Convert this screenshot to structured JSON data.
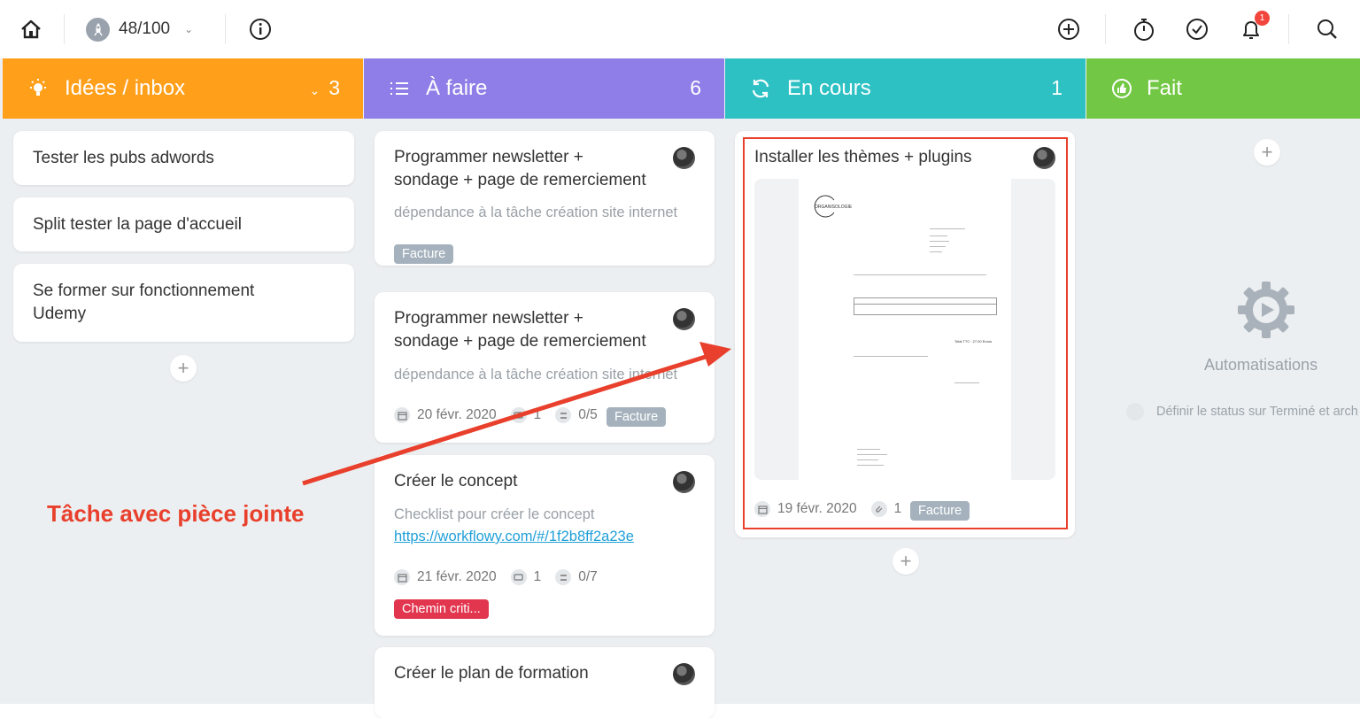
{
  "topbar": {
    "score": "48/100",
    "notification_count": "1"
  },
  "columns": [
    {
      "title": "Idées / inbox",
      "count": "3",
      "color": "#ff9f1a"
    },
    {
      "title": "À faire",
      "count": "6",
      "color": "#8f7ee7"
    },
    {
      "title": "En cours",
      "count": "1",
      "color": "#2ec1c4"
    },
    {
      "title": "Fait",
      "count": "",
      "color": "#72c744"
    }
  ],
  "inbox": {
    "cards": [
      {
        "title": "Tester les pubs adwords"
      },
      {
        "title": "Split tester la page d'accueil"
      },
      {
        "title_line1": "Se former sur fonctionnement",
        "title_line2": "Udemy"
      }
    ]
  },
  "todo": {
    "cards": [
      {
        "title_line1": "Programmer newsletter +",
        "title_line2": "sondage + page de remerciement",
        "desc": "dépendance à la tâche création site internet",
        "tag": "Facture"
      },
      {
        "title_line1": "Programmer newsletter +",
        "title_line2": "sondage + page de remerciement",
        "desc": "dépendance à la tâche création site internet",
        "date": "20 févr. 2020",
        "comments": "1",
        "checklist": "0/5",
        "tag": "Facture"
      },
      {
        "title": "Créer le concept",
        "desc": "Checklist pour créer le concept",
        "link": "https://workflowy.com/#/1f2b8ff2a23e",
        "date": "21 févr. 2020",
        "comments": "1",
        "checklist": "0/7",
        "tag": "Chemin criti..."
      },
      {
        "title": "Créer le plan de formation"
      }
    ]
  },
  "in_progress": {
    "card": {
      "title": "Installer les thèmes + plugins",
      "date": "19 févr. 2020",
      "attachments": "1",
      "tag": "Facture"
    }
  },
  "done": {
    "automations_label": "Automatisations",
    "rule_text": "Définir le status sur Terminé et arch"
  },
  "annotation": "Tâche avec pièce jointe",
  "invoice_preview": {
    "logo_text": "ORGANISOLOGIE",
    "total": "Total TTC : 27.00 Euros"
  }
}
